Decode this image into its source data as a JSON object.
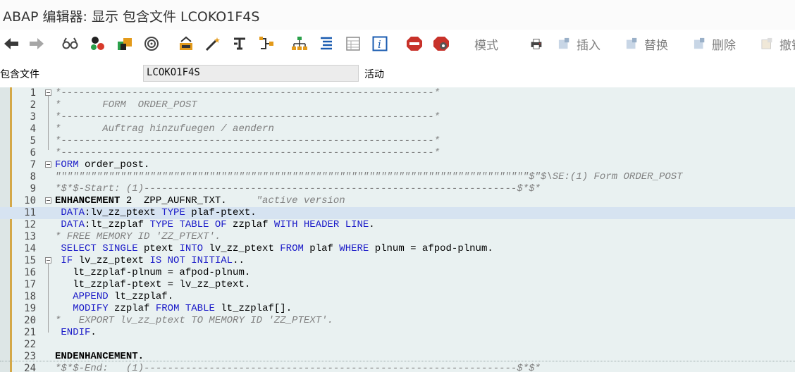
{
  "window": {
    "title": "ABAP 编辑器: 显示 包含文件 LCOKO1F4S"
  },
  "toolbar": {
    "icons": [
      "back-arrow-icon",
      "forward-arrow-icon",
      "glasses-icon",
      "balls-icon",
      "stack-icon",
      "spiral-icon",
      "tree-bin-icon",
      "magic-wand-icon",
      "indent-icon",
      "hierarchy-icon",
      "org-chart-icon",
      "list-icon",
      "table-icon",
      "info-icon",
      "stop-icon",
      "stop-gear-icon"
    ],
    "mode_label": "模式",
    "insert_label": "插入",
    "replace_label": "替换",
    "delete_label": "删除",
    "undo_label": "撤销"
  },
  "field": {
    "label": "包含文件",
    "value": "LCOKO1F4S",
    "status": "活动"
  },
  "editor": {
    "lines": [
      {
        "n": "1",
        "text": "*---------------------------------------------------------------*"
      },
      {
        "n": "2",
        "text": "*       FORM  ORDER_POST"
      },
      {
        "n": "3",
        "text": "*---------------------------------------------------------------*"
      },
      {
        "n": "4",
        "text": "*       Auftrag hinzufuegen / aendern"
      },
      {
        "n": "5",
        "text": "*---------------------------------------------------------------*"
      },
      {
        "n": "6",
        "text": "*---------------------------------------------------------------*"
      },
      {
        "n": "7",
        "text": "FORM order_post."
      },
      {
        "n": "8",
        "text": "\"\"\"\"\"\"\"\"\"\"\"\"\"\"\"\"\"\"\"\"\"\"\"\"\"\"\"\"\"\"\"\"\"\"\"\"\"\"\"\"\"\"\"\"\"\"\"\"\"\"\"\"\"\"\"\"\"\"\"\"\"\"\"\"\"\"\"\"\"\"\"\"\"\"\"\"\"\"\"\"$\"$\\SE:(1) Form ORDER_POST"
      },
      {
        "n": "9",
        "text": "*$*$-Start: (1)---------------------------------------------------------------$*$*"
      },
      {
        "n": "10",
        "text": "ENHANCEMENT 2  ZPP_AUFNR_TXT.     \"active version"
      },
      {
        "n": "11",
        "text": " DATA:lv_zz_ptext TYPE plaf-ptext."
      },
      {
        "n": "12",
        "text": " DATA:lt_zzplaf TYPE TABLE OF zzplaf WITH HEADER LINE."
      },
      {
        "n": "13",
        "text": "* FREE MEMORY ID 'ZZ_PTEXT'."
      },
      {
        "n": "14",
        "text": " SELECT SINGLE ptext INTO lv_zz_ptext FROM plaf WHERE plnum = afpod-plnum."
      },
      {
        "n": "15",
        "text": " IF lv_zz_ptext IS NOT INITIAL.."
      },
      {
        "n": "16",
        "text": "   lt_zzplaf-plnum = afpod-plnum."
      },
      {
        "n": "17",
        "text": "   lt_zzplaf-ptext = lv_zz_ptext."
      },
      {
        "n": "18",
        "text": "   APPEND lt_zzplaf."
      },
      {
        "n": "19",
        "text": "   MODIFY zzplaf FROM TABLE lt_zzplaf[]."
      },
      {
        "n": "20",
        "text": "*   EXPORT lv_zz_ptext TO MEMORY ID 'ZZ_PTEXT'."
      },
      {
        "n": "21",
        "text": " ENDIF."
      },
      {
        "n": "22",
        "text": ""
      },
      {
        "n": "23",
        "text": "ENDENHANCEMENT."
      },
      {
        "n": "24",
        "text": "*$*$-End:   (1)---------------------------------------------------------------$*$*"
      }
    ]
  }
}
